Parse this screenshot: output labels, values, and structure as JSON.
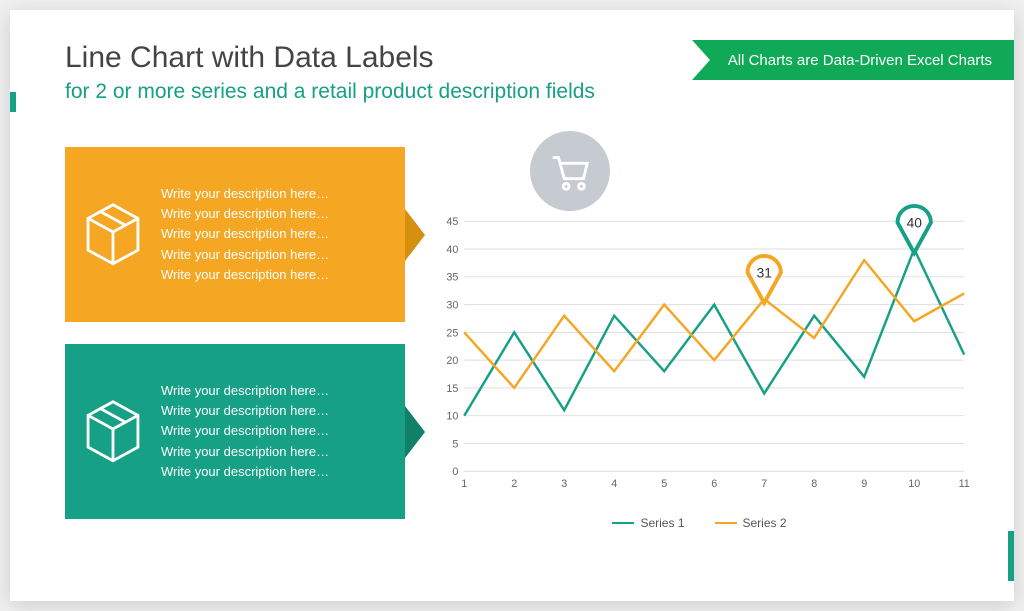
{
  "header": {
    "title": "Line Chart with Data Labels",
    "subtitle": "for 2 or more series and a retail product description fields",
    "ribbon": "All Charts are Data-Driven Excel Charts"
  },
  "cards": [
    {
      "placeholder": "Write your description here…",
      "lines": 5
    },
    {
      "placeholder": "Write your description here…",
      "lines": 5
    }
  ],
  "colors": {
    "teal": "#16a085",
    "orange": "#f5a623",
    "green": "#0fa958"
  },
  "chart_data": {
    "type": "line",
    "title": "",
    "xlabel": "",
    "ylabel": "",
    "categories": [
      "1",
      "2",
      "3",
      "4",
      "5",
      "6",
      "7",
      "8",
      "9",
      "10",
      "11"
    ],
    "y_ticks": [
      0,
      5,
      10,
      15,
      20,
      25,
      30,
      35,
      40,
      45
    ],
    "ylim": [
      0,
      45
    ],
    "series": [
      {
        "name": "Series 1",
        "color": "#16a085",
        "values": [
          10,
          25,
          11,
          28,
          18,
          30,
          14,
          28,
          17,
          40,
          21
        ]
      },
      {
        "name": "Series 2",
        "color": "#f5a623",
        "values": [
          25,
          15,
          28,
          18,
          30,
          20,
          31,
          24,
          38,
          27,
          32
        ]
      }
    ],
    "callouts": [
      {
        "series": 1,
        "index": 6,
        "value": 31,
        "color": "#f5a623"
      },
      {
        "series": 0,
        "index": 9,
        "value": 40,
        "color": "#16a085"
      }
    ]
  },
  "legend": {
    "s1": "Series 1",
    "s2": "Series 2"
  }
}
